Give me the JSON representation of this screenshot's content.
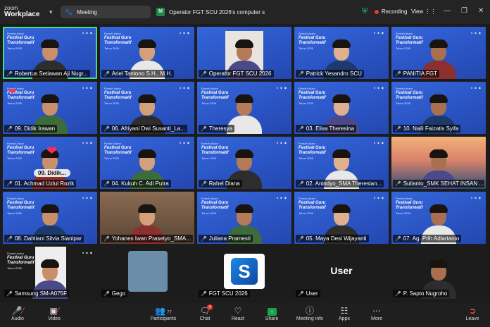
{
  "app": {
    "brand_top": "zoom",
    "brand_bottom": "Workplace"
  },
  "header": {
    "meeting_label": "Meeting",
    "meeting_title": "Operator FGT SCU 2026's computer s",
    "recording_label": "Recording",
    "view_label": "View"
  },
  "tile_branding": {
    "line1": "Festival Guru",
    "line2": "Transformatif",
    "small": "Tahun 2026",
    "top_small": "Pumah Asam"
  },
  "participants": [
    {
      "name": "Robertus Setiawan Aji Nugr..."
    },
    {
      "name": "Ariel Tantono S.H., M.H."
    },
    {
      "name": "Operator FGT SCU 2026"
    },
    {
      "name": "Patrick Yesandro SCU"
    },
    {
      "name": "PANITIA FGT"
    },
    {
      "name": "09. Didik Irawan"
    },
    {
      "name": "06. Afriyani Dwi Susanti_La..."
    },
    {
      "name": "Theresya"
    },
    {
      "name": "03. Elisa Theresina"
    },
    {
      "name": "10. Naili Faizatis Syifa"
    },
    {
      "name": "01. Achmad Uzlul Rozik"
    },
    {
      "name": "04. Kukuh C. Adi Putra"
    },
    {
      "name": "Rahel Diana"
    },
    {
      "name": "02. Anindyo_SMA Theresian..."
    },
    {
      "name": "Sulianto_SMK SEHAT INSAN ..."
    },
    {
      "name": "08. Dahliani Silvia Sianipar"
    },
    {
      "name": "Yohanes Iwan Prasetyo_SMA..."
    },
    {
      "name": "Juliana Pramesti"
    },
    {
      "name": "05. Maya Desi Wijayanti"
    },
    {
      "name": "07. Ag. Prih Adiartanto"
    },
    {
      "name": "Samsung SM-A075F"
    },
    {
      "name": "Gego"
    },
    {
      "name": "FGT SCU 2026"
    },
    {
      "name": "User"
    },
    {
      "name": "P. Sapto Nugroho"
    }
  ],
  "reaction_bubble": "09. Didik...",
  "user_tile_text": "User",
  "toolbar": {
    "audio": "Audio",
    "video": "Video",
    "participants": "Participants",
    "participants_count": "77",
    "chat": "Chat",
    "chat_badge": "4",
    "react": "React",
    "share": "Share",
    "meeting_info": "Meeting info",
    "apps": "Apps",
    "more": "More",
    "leave": "Leave"
  },
  "colors": {
    "accent_green": "#3de08a",
    "record_red": "#e53935",
    "tile_blue": "#2a55c8",
    "share_green": "#19a34a"
  }
}
